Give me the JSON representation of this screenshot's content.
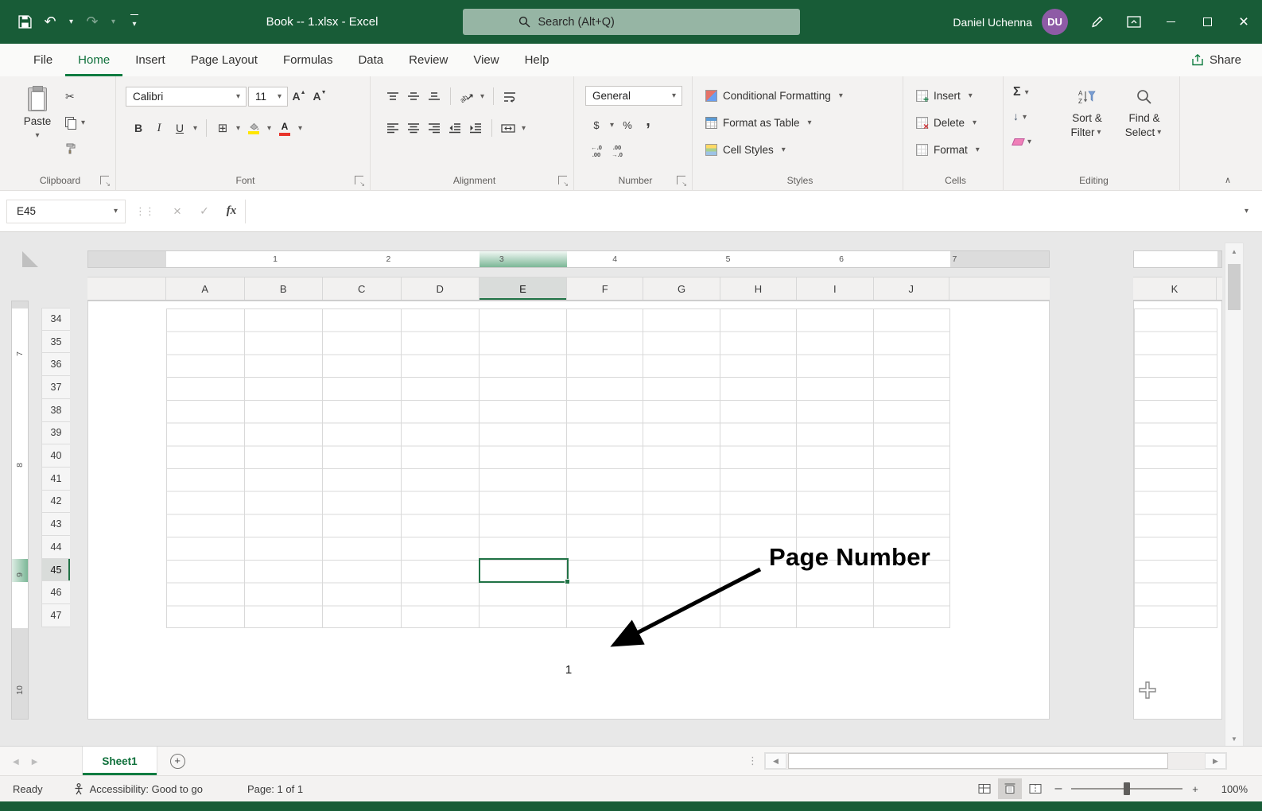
{
  "titlebar": {
    "title": "Book -- 1.xlsx - Excel",
    "search_placeholder": "Search (Alt+Q)",
    "user_name": "Daniel Uchenna",
    "avatar_initials": "DU"
  },
  "ribbon_tabs": {
    "items": [
      "File",
      "Home",
      "Insert",
      "Page Layout",
      "Formulas",
      "Data",
      "Review",
      "View",
      "Help"
    ],
    "active": "Home",
    "share_label": "Share"
  },
  "ribbon": {
    "group_labels": [
      "Clipboard",
      "Font",
      "Alignment",
      "Number",
      "Styles",
      "Cells",
      "Editing"
    ],
    "clipboard": {
      "paste": "Paste"
    },
    "font": {
      "family": "Calibri",
      "size": "11",
      "bold": "B",
      "italic": "I",
      "underline": "U"
    },
    "number": {
      "format": "General",
      "currency": "$",
      "percent": "%",
      "comma": ","
    },
    "styles": {
      "conditional_formatting": "Conditional Formatting",
      "format_as_table": "Format as Table",
      "cell_styles": "Cell Styles"
    },
    "cells": {
      "insert": "Insert",
      "delete": "Delete",
      "format": "Format"
    },
    "editing": {
      "autosum": "Σ",
      "sort_line1": "Sort &",
      "sort_line2": "Filter",
      "find_line1": "Find &",
      "find_line2": "Select"
    }
  },
  "formula_bar": {
    "name_box": "E45",
    "fx": "fx",
    "value": ""
  },
  "sheet": {
    "horizontal_ruler_marks": [
      "1",
      "2",
      "3",
      "4",
      "5",
      "6",
      "7"
    ],
    "vertical_ruler_marks": [
      "7",
      "8",
      "9",
      "10"
    ],
    "columns": [
      "A",
      "B",
      "C",
      "D",
      "E",
      "F",
      "G",
      "H",
      "I",
      "J"
    ],
    "page2_column": "K",
    "rows": [
      "34",
      "35",
      "36",
      "37",
      "38",
      "39",
      "40",
      "41",
      "42",
      "43",
      "44",
      "45",
      "46",
      "47"
    ],
    "selected_cell": "E45",
    "selected_column": "E",
    "selected_row": "45",
    "annotation_text": "Page Number",
    "footer_page_number": "1"
  },
  "sheet_tabs": {
    "active": "Sheet1"
  },
  "status_bar": {
    "mode": "Ready",
    "accessibility": "Accessibility: Good to go",
    "page_info": "Page: 1 of 1",
    "zoom_level": "100%"
  },
  "colors": {
    "title_bar_green": "#185c37",
    "accent_green": "#107c41",
    "selection_border_green": "#217346",
    "avatar_purple": "#8e5ba6",
    "fill_color_yellow": "#ffe600",
    "font_color_red": "#e8352c"
  }
}
